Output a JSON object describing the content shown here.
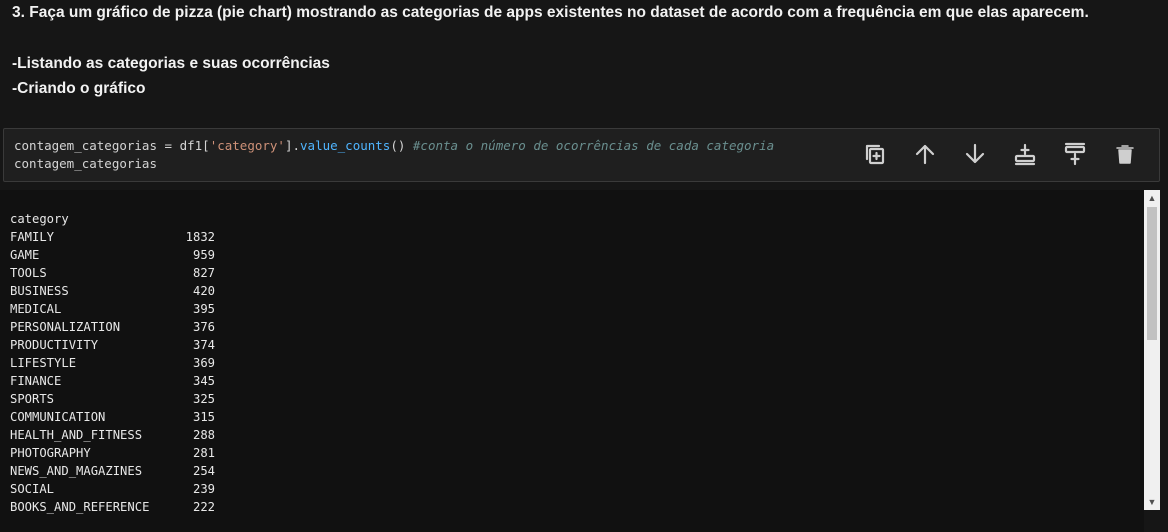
{
  "markdown": {
    "title": "3. Faça um gráfico de pizza (pie chart) mostrando as categorias de apps existentes no dataset de acordo com a frequência em que elas aparecem.",
    "bullet1": "-Listando as categorias e suas ocorrências",
    "bullet2": "-Criando o gráfico"
  },
  "code": {
    "l1_var": "contagem_categorias",
    "l1_op": " = ",
    "l1_df": "df1[",
    "l1_str": "'category'",
    "l1_close": "].",
    "l1_fn": "value_counts",
    "l1_paren": "() ",
    "l1_comment": "#conta o número de ocorrências de cada categoria",
    "l2_var": "contagem_categorias"
  },
  "toolbar": {
    "icons": [
      "copy-icon",
      "arrow-up-icon",
      "arrow-down-icon",
      "insert-above-icon",
      "insert-below-icon",
      "trash-icon"
    ]
  },
  "output": {
    "header": "category",
    "rows": [
      {
        "name": "FAMILY",
        "count": "1832"
      },
      {
        "name": "GAME",
        "count": "959"
      },
      {
        "name": "TOOLS",
        "count": "827"
      },
      {
        "name": "BUSINESS",
        "count": "420"
      },
      {
        "name": "MEDICAL",
        "count": "395"
      },
      {
        "name": "PERSONALIZATION",
        "count": "376"
      },
      {
        "name": "PRODUCTIVITY",
        "count": "374"
      },
      {
        "name": "LIFESTYLE",
        "count": "369"
      },
      {
        "name": "FINANCE",
        "count": "345"
      },
      {
        "name": "SPORTS",
        "count": "325"
      },
      {
        "name": "COMMUNICATION",
        "count": "315"
      },
      {
        "name": "HEALTH_AND_FITNESS",
        "count": "288"
      },
      {
        "name": "PHOTOGRAPHY",
        "count": "281"
      },
      {
        "name": "NEWS_AND_MAGAZINES",
        "count": "254"
      },
      {
        "name": "SOCIAL",
        "count": "239"
      },
      {
        "name": "BOOKS_AND_REFERENCE",
        "count": "222"
      }
    ]
  },
  "colors": {
    "background": "#161616",
    "string": "#ce9178",
    "function": "#4fb5ff",
    "comment": "#6a8f8f"
  }
}
